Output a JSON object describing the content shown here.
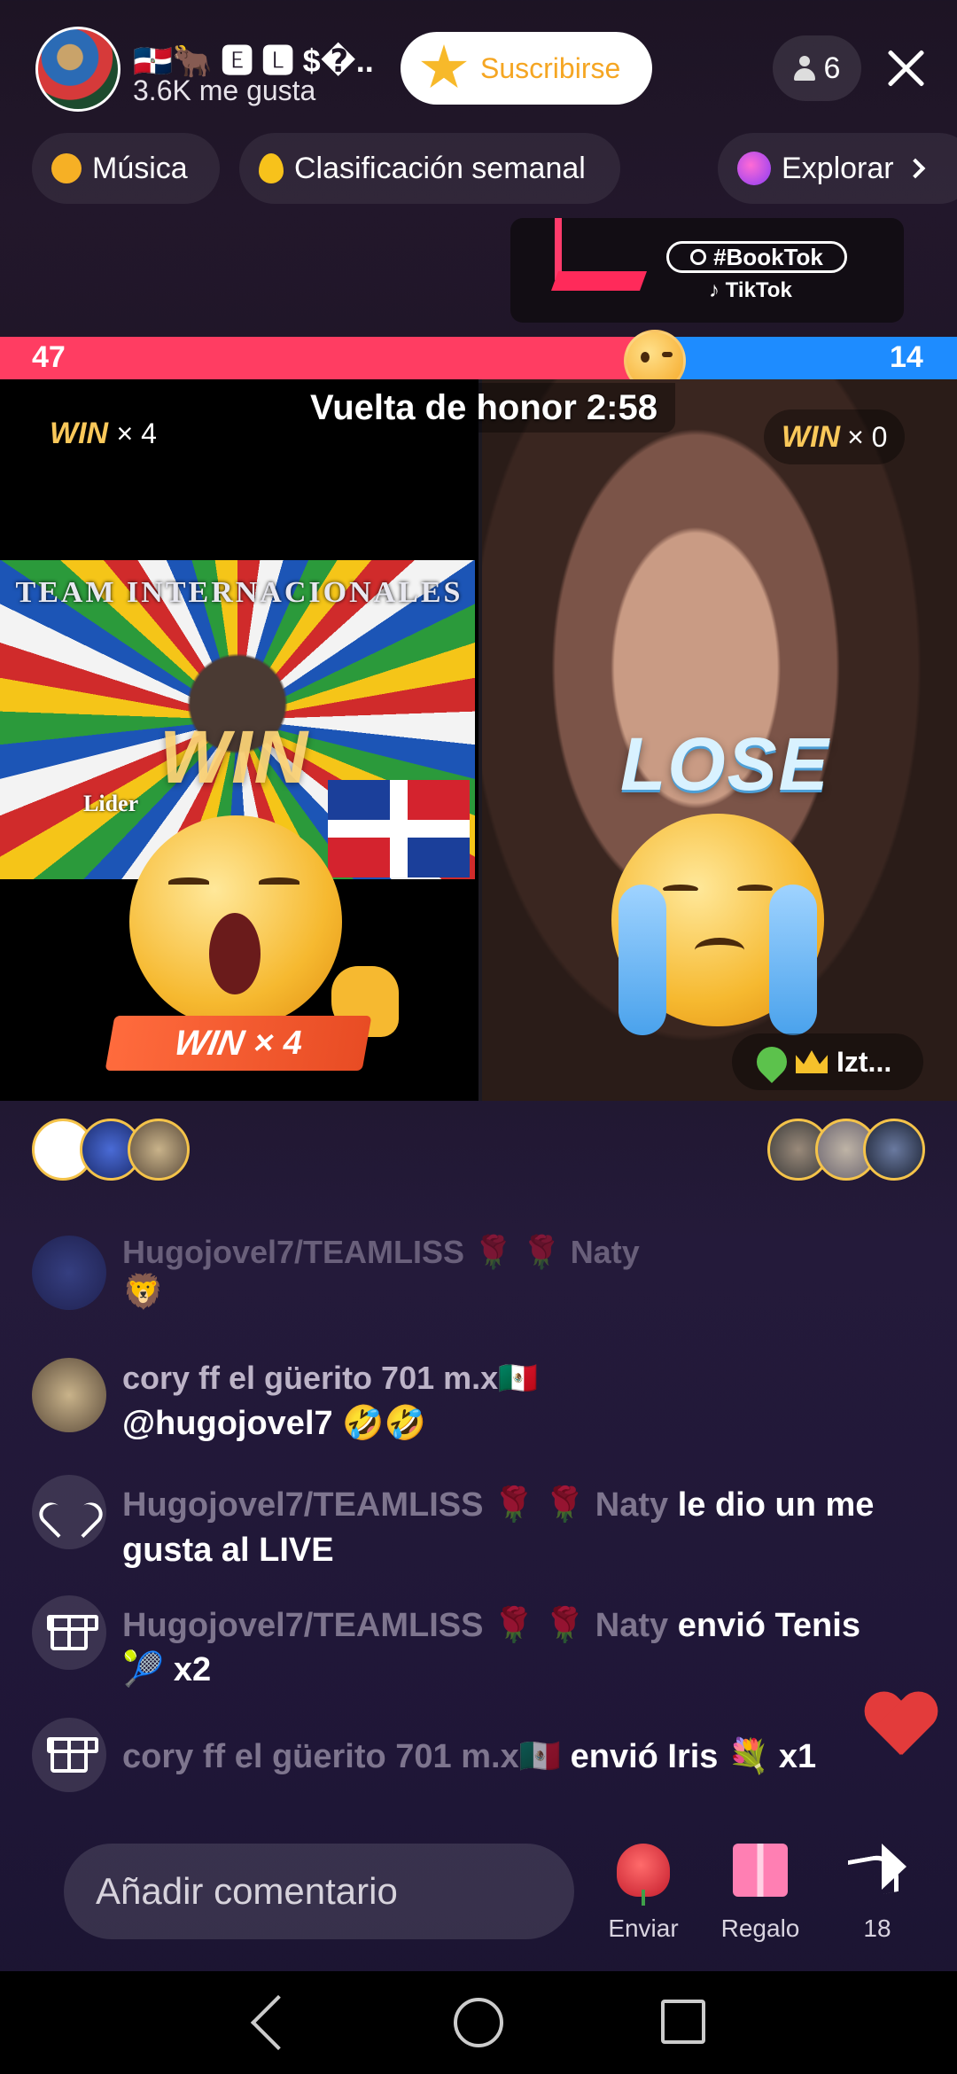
{
  "header": {
    "host_name": "🇩🇴🐂 🅴 🅻 $�..",
    "likes": "3.6K me gusta",
    "subscribe_label": "Suscribirse",
    "viewer_count": "6"
  },
  "chips": {
    "music": "Música",
    "ranking": "Clasificación semanal",
    "explore": "Explorar"
  },
  "banner": {
    "tag": "#BookTok",
    "brand": "♪ TikTok"
  },
  "battle": {
    "score_left": "47",
    "score_right": "14",
    "left_score_fraction": 0.77,
    "timer": "Vuelta de honor 2:58",
    "left_win_label": "WIN",
    "left_win_count": "× 4",
    "right_win_label": "WIN",
    "right_win_count": "× 0",
    "result_left": "WIN",
    "result_right": "LOSE",
    "ribbon_label": "WIN",
    "ribbon_count": "× 4",
    "arc_title": "TEAM INTERNACIONALES",
    "lider_label": "Lider",
    "opponent_name": "Izt..."
  },
  "comments": [
    {
      "name": "Hugojovel7/TEAMLISS 🌹 🌹 Naty",
      "text": "🦁",
      "faded": true
    },
    {
      "name": "cory ff el güerito 701 m.x🇲🇽",
      "text": "@hugojovel7 🤣🤣"
    },
    {
      "name": "Hugojovel7/TEAMLISS 🌹 🌹 Naty",
      "suffix": "le dio un me",
      "text": "gusta al LIVE",
      "icon": "heart-icon"
    },
    {
      "name": "Hugojovel7/TEAMLISS 🌹 🌹 Naty",
      "suffix": "envió Tenis",
      "text": "🎾 x2",
      "icon": "gift-icon"
    },
    {
      "name": "cory ff el güerito 701 m.x🇲🇽",
      "suffix": "envió Iris 💐 x1",
      "icon": "gift-icon"
    }
  ],
  "bottom": {
    "comment_placeholder": "Añadir comentario",
    "send_label": "Enviar",
    "gift_label": "Regalo",
    "share_count": "18"
  }
}
